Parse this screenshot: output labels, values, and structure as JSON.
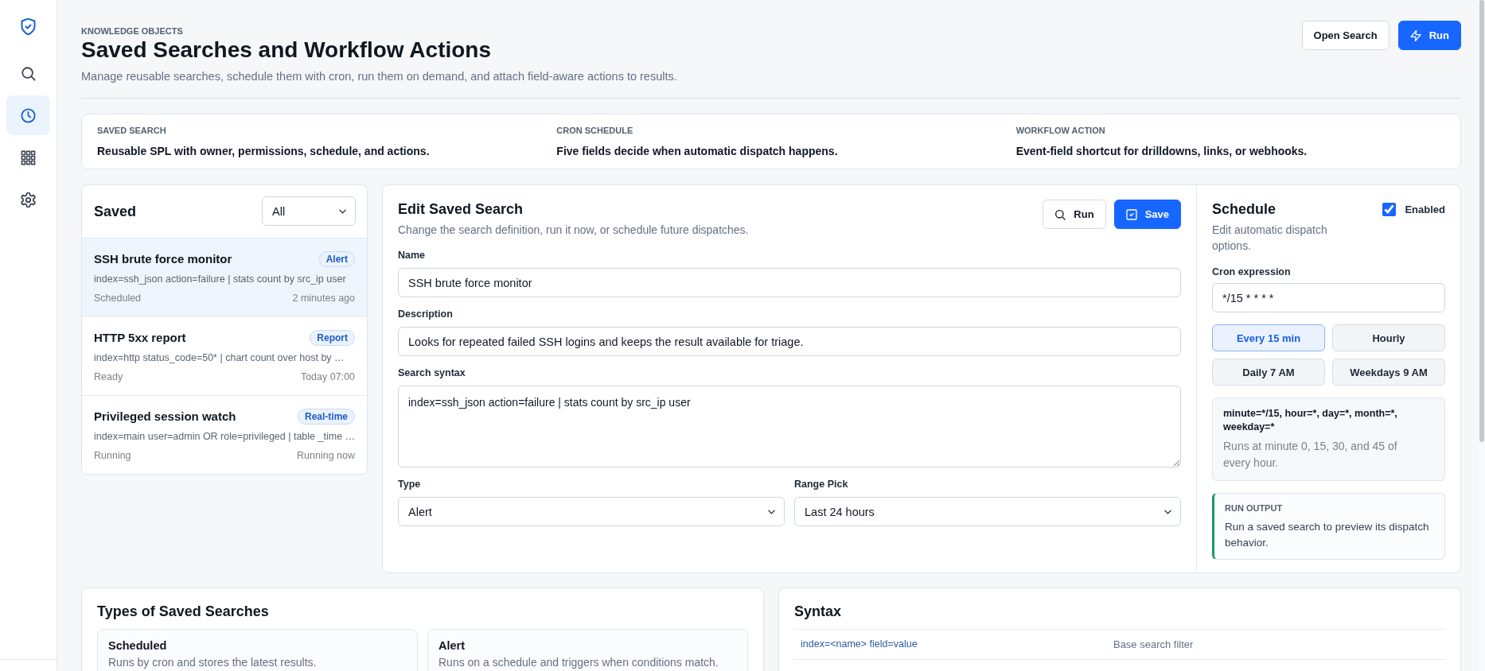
{
  "sidebar": {
    "items": [
      {
        "selected": false
      },
      {
        "selected": true
      },
      {
        "selected": false
      },
      {
        "selected": false
      }
    ]
  },
  "header": {
    "eyebrow": "KNOWLEDGE OBJECTS",
    "title": "Saved Searches and Workflow Actions",
    "subtitle": "Manage reusable searches, schedule them with cron, run them on demand, and attach field-aware actions to results.",
    "actions": [
      {
        "kind": "secondary",
        "label": "Open Search"
      },
      {
        "kind": "primary",
        "label": "Run"
      }
    ]
  },
  "concepts": [
    {
      "label": "SAVED SEARCH",
      "text": "Reusable SPL with owner, permissions, schedule, and actions."
    },
    {
      "label": "CRON SCHEDULE",
      "text": "Five fields decide when automatic dispatch happens."
    },
    {
      "label": "WORKFLOW ACTION",
      "text": "Event-field shortcut for drilldowns, links, or webhooks."
    }
  ],
  "saved": {
    "title": "Saved",
    "filter": "All",
    "items": [
      {
        "name": "SSH brute force monitor",
        "type": "Alert",
        "query": "index=ssh_json action=failure | stats count by src_ip user",
        "status": "Scheduled",
        "time": "2 minutes ago",
        "selected": true
      },
      {
        "name": "HTTP 5xx report",
        "type": "Report",
        "query": "index=http status_code=50* | chart count over host by …",
        "status": "Ready",
        "time": "Today 07:00",
        "selected": false
      },
      {
        "name": "Privileged session watch",
        "type": "Real-time",
        "query": "index=main user=admin OR role=privileged | table _time …",
        "status": "Running",
        "time": "Running now",
        "selected": false
      }
    ]
  },
  "editor": {
    "title": "Edit Saved Search",
    "subtitle": "Change the search definition, run it now, or schedule future dispatches.",
    "actions": [
      {
        "kind": "secondary",
        "label": "Run"
      },
      {
        "kind": "primary",
        "label": "Save"
      }
    ],
    "fields": [
      {
        "kind": "text",
        "label": "Name",
        "value": "SSH brute force monitor"
      },
      {
        "kind": "text",
        "label": "Description",
        "value": "Looks for repeated failed SSH logins and keeps the result available for triage."
      },
      {
        "kind": "textarea",
        "label": "Search syntax",
        "value": "index=ssh_json action=failure | stats count by src_ip user"
      }
    ],
    "selects": [
      {
        "label": "Type",
        "value": "Alert"
      },
      {
        "label": "Range Pick",
        "value": "Last 24 hours"
      }
    ]
  },
  "schedule": {
    "title": "Schedule",
    "subtitle": "Edit automatic dispatch options.",
    "enabled": {
      "label": "Enabled",
      "checked": true
    },
    "cron": {
      "label": "Cron expression",
      "value": "*/15 * * * *"
    },
    "presets": [
      {
        "label": "Every 15 min",
        "selected": true
      },
      {
        "label": "Hourly",
        "selected": false
      },
      {
        "label": "Daily 7 AM",
        "selected": false
      },
      {
        "label": "Weekdays 9 AM",
        "selected": false
      }
    ],
    "summary": {
      "fields": "minute=*/15, hour=*, day=*, month=*, weekday=*",
      "text": "Runs at minute 0, 15, 30, and 45 of every hour."
    },
    "output": {
      "label": "RUN OUTPUT",
      "text": "Run a saved search to preview its dispatch behavior."
    }
  },
  "types": {
    "title": "Types of Saved Searches",
    "items": [
      {
        "name": "Scheduled",
        "text": "Runs by cron and stores the latest results."
      },
      {
        "name": "Alert",
        "text": "Runs on a schedule and triggers when conditions match."
      }
    ]
  },
  "syntax": {
    "title": "Syntax",
    "rows": [
      {
        "code": "index=<name> field=value",
        "meaning": "Base search filter"
      }
    ]
  }
}
